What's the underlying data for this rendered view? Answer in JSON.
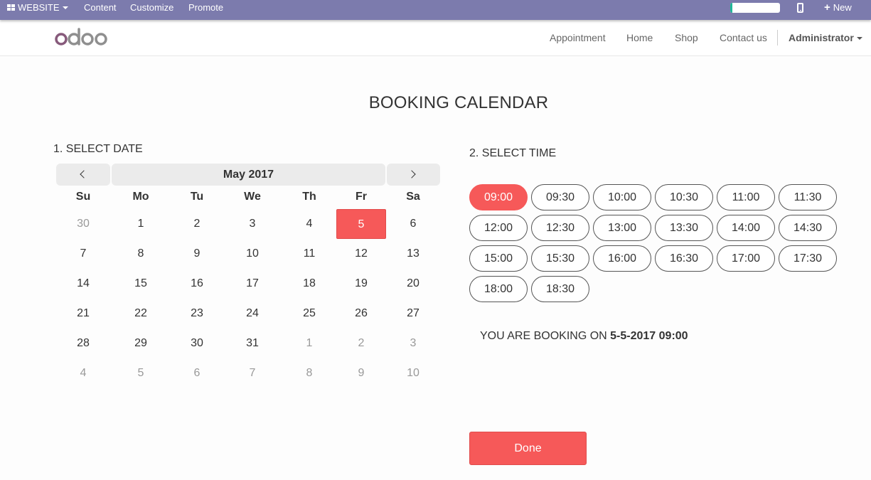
{
  "topbar": {
    "website_label": "WEBSITE",
    "menu": [
      "Content",
      "Customize",
      "Promote"
    ],
    "progress": 0.04,
    "new_label": "New",
    "color": "#7c7bad"
  },
  "header": {
    "logo_text": "odoo",
    "nav": [
      "Appointment",
      "Home",
      "Shop",
      "Contact us"
    ],
    "user": "Administrator"
  },
  "page": {
    "title": "BOOKING CALENDAR",
    "date_label": "1. SELECT DATE",
    "time_label": "2. SELECT TIME",
    "booking_prefix": "YOU ARE BOOKING ON ",
    "booking_value": "5-5-2017 09:00",
    "done_label": "Done",
    "accent": "#f65959"
  },
  "calendar": {
    "month_label": "May 2017",
    "weekdays": [
      "Su",
      "Mo",
      "Tu",
      "We",
      "Th",
      "Fr",
      "Sa"
    ],
    "weeks": [
      [
        {
          "d": "30",
          "muted": true
        },
        {
          "d": "1"
        },
        {
          "d": "2"
        },
        {
          "d": "3"
        },
        {
          "d": "4"
        },
        {
          "d": "5",
          "selected": true
        },
        {
          "d": "6"
        }
      ],
      [
        {
          "d": "7"
        },
        {
          "d": "8"
        },
        {
          "d": "9"
        },
        {
          "d": "10"
        },
        {
          "d": "11"
        },
        {
          "d": "12"
        },
        {
          "d": "13"
        }
      ],
      [
        {
          "d": "14"
        },
        {
          "d": "15"
        },
        {
          "d": "16"
        },
        {
          "d": "17"
        },
        {
          "d": "18"
        },
        {
          "d": "19"
        },
        {
          "d": "20"
        }
      ],
      [
        {
          "d": "21"
        },
        {
          "d": "22"
        },
        {
          "d": "23"
        },
        {
          "d": "24"
        },
        {
          "d": "25"
        },
        {
          "d": "26"
        },
        {
          "d": "27"
        }
      ],
      [
        {
          "d": "28"
        },
        {
          "d": "29"
        },
        {
          "d": "30"
        },
        {
          "d": "31"
        },
        {
          "d": "1",
          "muted": true
        },
        {
          "d": "2",
          "muted": true
        },
        {
          "d": "3",
          "muted": true
        }
      ],
      [
        {
          "d": "4",
          "muted": true
        },
        {
          "d": "5",
          "muted": true
        },
        {
          "d": "6",
          "muted": true
        },
        {
          "d": "7",
          "muted": true
        },
        {
          "d": "8",
          "muted": true
        },
        {
          "d": "9",
          "muted": true
        },
        {
          "d": "10",
          "muted": true
        }
      ]
    ]
  },
  "times": {
    "slots": [
      "09:00",
      "09:30",
      "10:00",
      "10:30",
      "11:00",
      "11:30",
      "12:00",
      "12:30",
      "13:00",
      "13:30",
      "14:00",
      "14:30",
      "15:00",
      "15:30",
      "16:00",
      "16:30",
      "17:00",
      "17:30",
      "18:00",
      "18:30"
    ],
    "selected": "09:00"
  }
}
